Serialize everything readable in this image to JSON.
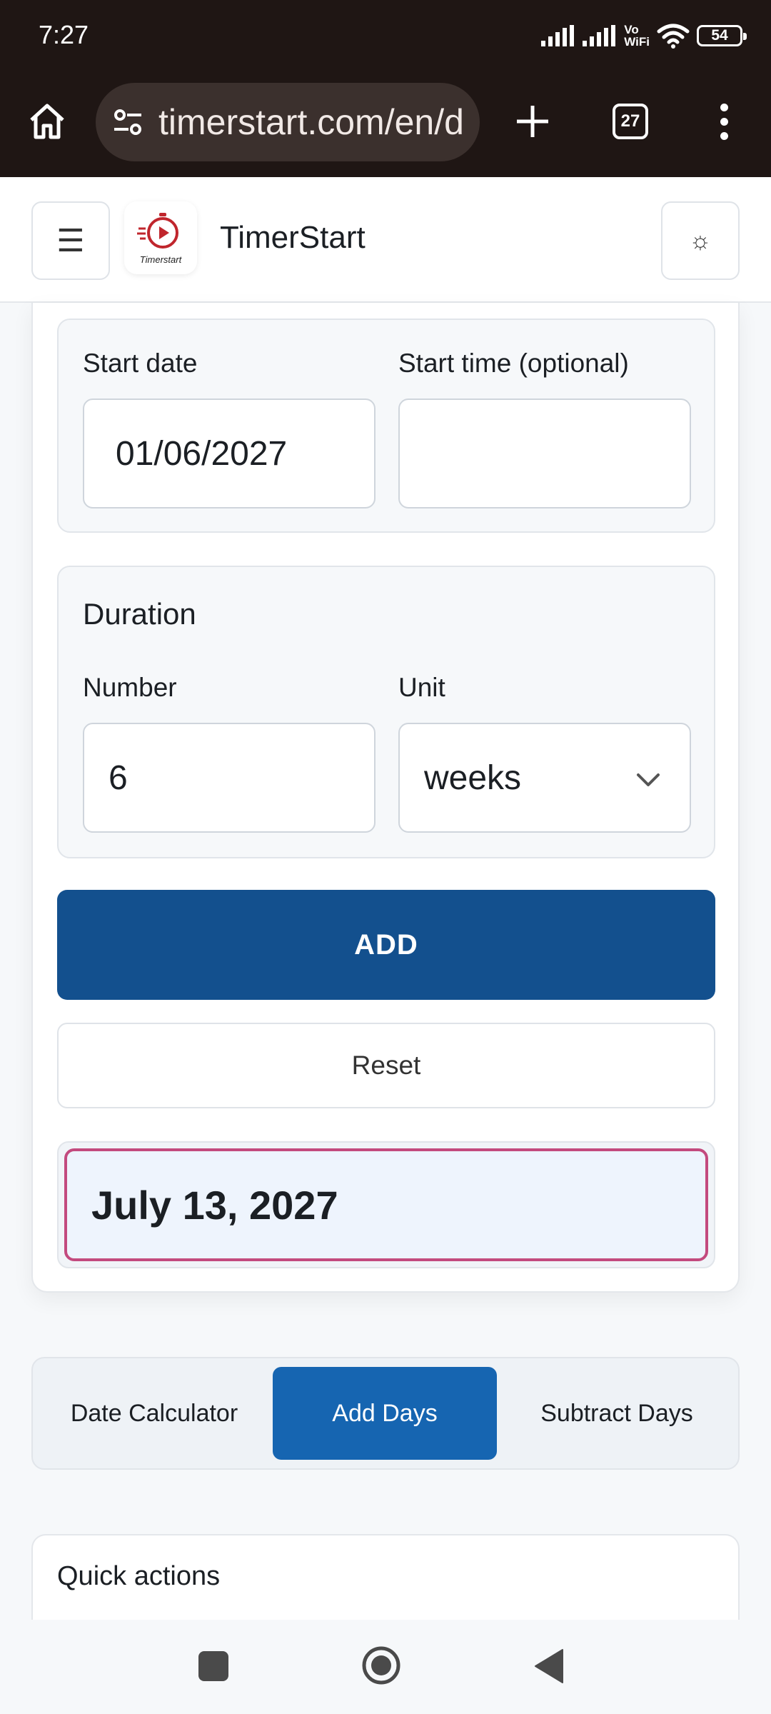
{
  "status": {
    "time": "7:27",
    "network_label": "Vo\nWiFi",
    "battery": "54"
  },
  "browser": {
    "url": "timerstart.com/en/d",
    "tab_count": "27",
    "icons": [
      "home-icon",
      "tune-icon",
      "plus-icon",
      "tabs-icon",
      "more-vert-icon"
    ]
  },
  "header": {
    "menu_glyph": "☰",
    "logo_text": "Timerstart",
    "title": "TimerStart",
    "theme_glyph": "☼"
  },
  "form": {
    "start_date_label": "Start date",
    "start_date_value": "01/06/2027",
    "start_time_label": "Start time (optional)",
    "start_time_value": "",
    "duration_title": "Duration",
    "number_label": "Number",
    "number_value": "6",
    "unit_label": "Unit",
    "unit_value": "weeks",
    "add_label": "ADD",
    "reset_label": "Reset",
    "result": "July 13, 2027"
  },
  "tabs": [
    {
      "label": "Date Calculator",
      "active": false
    },
    {
      "label": "Add Days",
      "active": true
    },
    {
      "label": "Subtract Days",
      "active": false
    }
  ],
  "quick_actions": {
    "title": "Quick actions"
  },
  "colors": {
    "primary_button": "#13508e",
    "active_tab": "#1665b1",
    "result_border": "#c34a7e",
    "browser_chrome": "#1f1614"
  }
}
